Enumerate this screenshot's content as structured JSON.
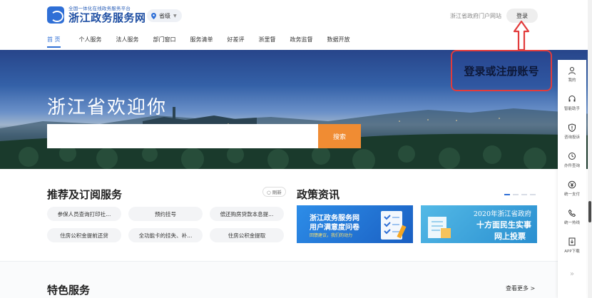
{
  "header": {
    "logo_subtitle": "全国一体化在线政务服务平台",
    "logo_title": "浙江政务服务网",
    "region": "省级",
    "portal_link": "浙江省政府门户网站",
    "login": "登录"
  },
  "nav": {
    "items": [
      "首 页",
      "个人服务",
      "法人服务",
      "部门窗口",
      "服务清单",
      "好差评",
      "浙里督",
      "政务监督",
      "数据开放"
    ]
  },
  "hero": {
    "title": "浙江省欢迎你",
    "search_placeholder": "",
    "search_button": "搜索"
  },
  "annotation": {
    "text": "登录或注册账号",
    "color": "#e23b3b"
  },
  "side_toolbar": {
    "items": [
      {
        "label": "我的",
        "icon": "user-icon"
      },
      {
        "label": "智能助手",
        "icon": "headset-icon"
      },
      {
        "label": "咨询投诉",
        "icon": "shield-icon"
      },
      {
        "label": "办件查询",
        "icon": "history-icon"
      },
      {
        "label": "统一支付",
        "icon": "yuan-icon"
      },
      {
        "label": "统一热线",
        "icon": "phone-icon"
      },
      {
        "label": "APP下载",
        "icon": "download-icon"
      }
    ]
  },
  "recommend": {
    "title": "推荐及订阅服务",
    "refresh": "○ 刷新",
    "chips": [
      "参保人员查询打印社...",
      "预约挂号",
      "偿还购房贷款本息提...",
      "住房公积金提前还贷",
      "全功能卡的挂失、补...",
      "住房公积金提取"
    ]
  },
  "policy": {
    "title": "政策资讯",
    "banner_a": {
      "line1": "浙江政务服务网",
      "line2": "用户满意度问卷",
      "line3": "回馈建议，我们的动力"
    },
    "banner_b": {
      "line1": "2020年浙江省政府",
      "line2": "十方面民生实事",
      "line3": "网上投票"
    }
  },
  "featured": {
    "title": "特色服务",
    "more": "查看更多 >"
  },
  "colors": {
    "brand_blue": "#2f6fd6",
    "search_orange": "#f08c33"
  }
}
